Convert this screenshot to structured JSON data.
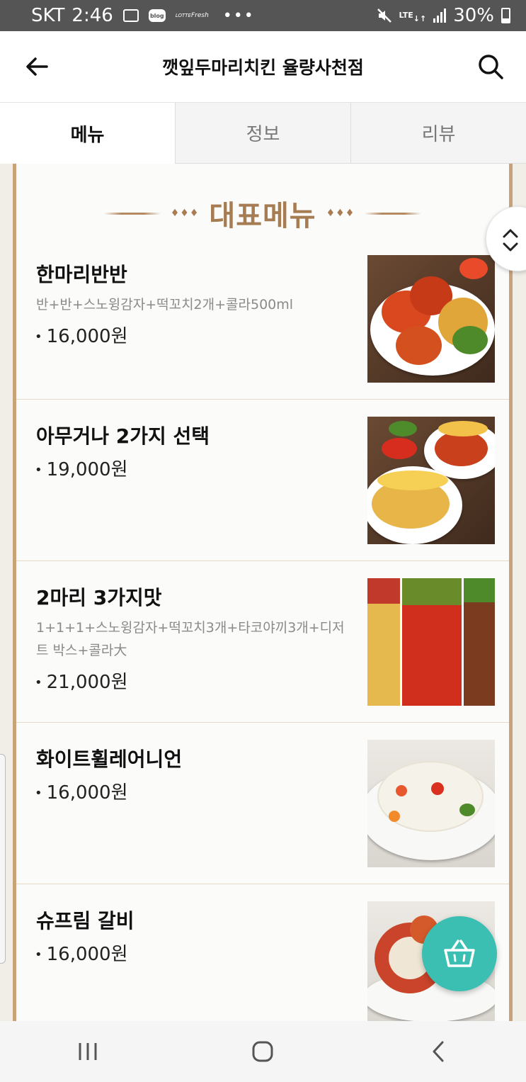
{
  "status_bar": {
    "carrier": "SKT",
    "time": "2:46",
    "icons": [
      "image-icon",
      "blog-icon",
      "lotte-fresh-icon",
      "more-dots-icon",
      "mute-icon",
      "lte-icon",
      "signal-icon",
      "battery-icon"
    ],
    "blog_label": "blog",
    "lotte_label": "LOTTE",
    "fresh_label": "Fresh",
    "dots": "•••",
    "lte": "LTE",
    "battery": "30%"
  },
  "header": {
    "title": "깻잎두마리치킨 율량사천점",
    "back_icon": "arrow-left-icon",
    "search_icon": "search-icon"
  },
  "tabs": [
    {
      "label": "메뉴",
      "active": true
    },
    {
      "label": "정보",
      "active": false
    },
    {
      "label": "리뷰",
      "active": false
    }
  ],
  "section": {
    "title": "대표메뉴",
    "diamonds": "♦♦♦"
  },
  "menu_items": [
    {
      "name": "한마리반반",
      "desc": "반+반+스노윙감자+떡꼬치2개+콜라500ml",
      "price": "16,000원"
    },
    {
      "name": "아무거나 2가지 선택",
      "desc": "",
      "price": "19,000원"
    },
    {
      "name": "2마리 3가지맛",
      "desc": "1+1+1+스노윙감자+떡꼬치3개+타코야끼3개+디저트 박스+콜라大",
      "price": "21,000원"
    },
    {
      "name": "화이트휠레어니언",
      "desc": "",
      "price": "16,000원"
    },
    {
      "name": "슈프림 갈비",
      "desc": "",
      "price": "16,000원"
    }
  ],
  "bullet": "•",
  "colors": {
    "accent_brown": "#a67c52",
    "frame_border": "#c9a27a",
    "cart_teal": "#3bbfb3"
  },
  "nav": {
    "recent_icon": "recent-apps-icon",
    "home_icon": "home-icon",
    "back_icon": "back-icon"
  }
}
